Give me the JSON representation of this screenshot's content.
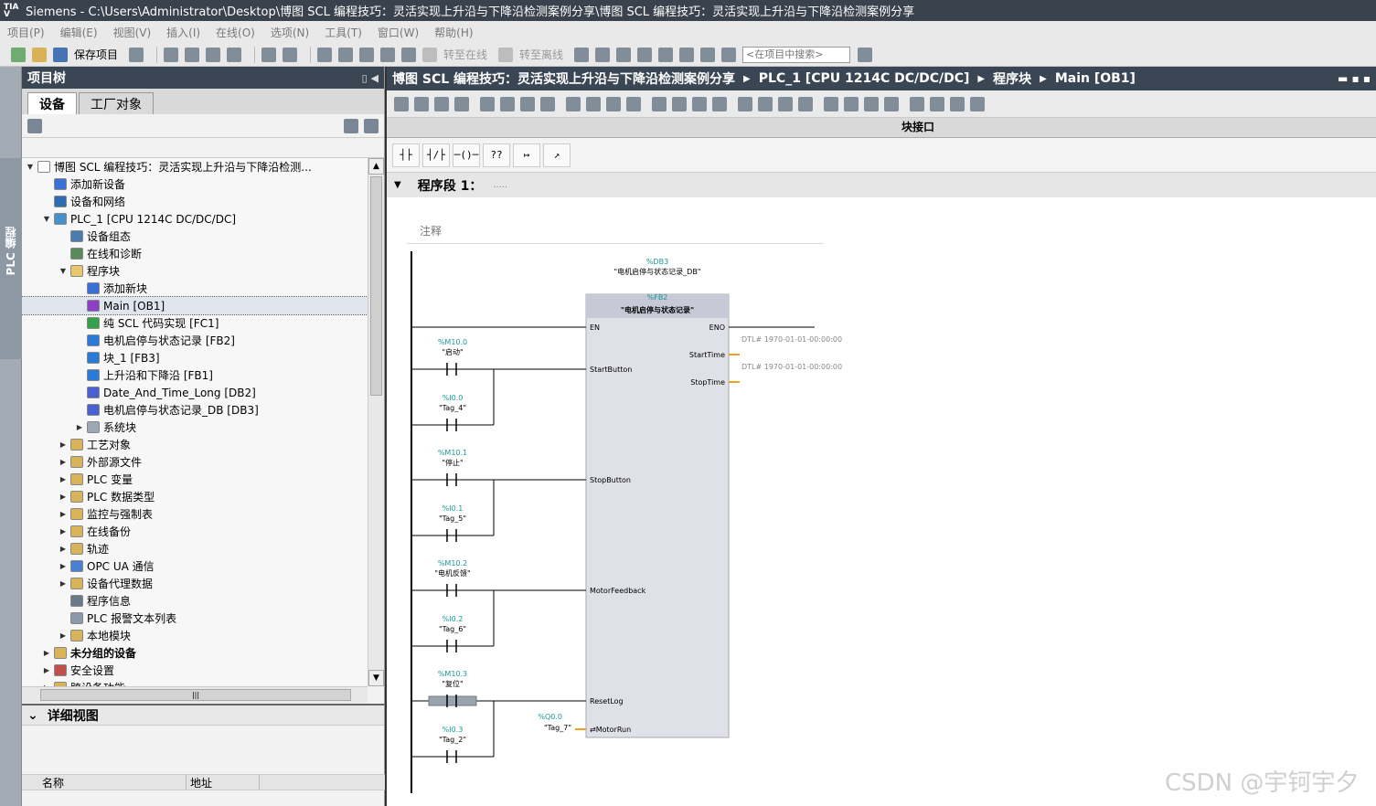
{
  "window": {
    "title": "Siemens  -  C:\\Users\\Administrator\\Desktop\\博图 SCL 编程技巧：灵活实现上升沿与下降沿检测案例分享\\博图 SCL 编程技巧：灵活实现上升沿与下降沿检测案例分享",
    "logo": "TIA"
  },
  "menu": [
    "项目(P)",
    "编辑(E)",
    "视图(V)",
    "插入(I)",
    "在线(O)",
    "选项(N)",
    "工具(T)",
    "窗口(W)",
    "帮助(H)"
  ],
  "toolbar": {
    "save_label": "保存项目",
    "go_online": "转至在线",
    "go_offline": "转至离线",
    "search_placeholder": "<在项目中搜索>"
  },
  "side_strip_label": "PLC 编程",
  "project_tree": {
    "title": "项目树",
    "tabs": [
      "设备",
      "工厂对象"
    ],
    "items": [
      {
        "label": "博图 SCL 编程技巧：灵活实现上升沿与下降沿检测...",
        "indent": 0,
        "arrow": "▼",
        "color": "#ffffff"
      },
      {
        "label": "添加新设备",
        "indent": 1,
        "arrow": "",
        "color": "#3a6fd8"
      },
      {
        "label": "设备和网络",
        "indent": 1,
        "arrow": "",
        "color": "#2d6cb3"
      },
      {
        "label": "PLC_1 [CPU 1214C DC/DC/DC]",
        "indent": 1,
        "arrow": "▼",
        "color": "#4a90c8"
      },
      {
        "label": "设备组态",
        "indent": 2,
        "arrow": "",
        "color": "#4a7cb0"
      },
      {
        "label": "在线和诊断",
        "indent": 2,
        "arrow": "",
        "color": "#5a8a5a"
      },
      {
        "label": "程序块",
        "indent": 2,
        "arrow": "▼",
        "color": "#e7c76b"
      },
      {
        "label": "添加新块",
        "indent": 3,
        "arrow": "",
        "color": "#3a6fd8"
      },
      {
        "label": "Main [OB1]",
        "indent": 3,
        "arrow": "",
        "color": "#8f3fc6",
        "selected": true
      },
      {
        "label": "纯 SCL 代码实现 [FC1]",
        "indent": 3,
        "arrow": "",
        "color": "#33a14a"
      },
      {
        "label": "电机启停与状态记录 [FB2]",
        "indent": 3,
        "arrow": "",
        "color": "#2a7ad8"
      },
      {
        "label": "块_1 [FB3]",
        "indent": 3,
        "arrow": "",
        "color": "#2a7ad8"
      },
      {
        "label": "上升沿和下降沿 [FB1]",
        "indent": 3,
        "arrow": "",
        "color": "#2a7ad8"
      },
      {
        "label": "Date_And_Time_Long [DB2]",
        "indent": 3,
        "arrow": "",
        "color": "#4a5fd0"
      },
      {
        "label": "电机启停与状态记录_DB [DB3]",
        "indent": 3,
        "arrow": "",
        "color": "#4a5fd0"
      },
      {
        "label": "系统块",
        "indent": 3,
        "arrow": "▶",
        "color": "#9ca8b5"
      },
      {
        "label": "工艺对象",
        "indent": 2,
        "arrow": "▶",
        "color": "#d9b35a"
      },
      {
        "label": "外部源文件",
        "indent": 2,
        "arrow": "▶",
        "color": "#d9b35a"
      },
      {
        "label": "PLC 变量",
        "indent": 2,
        "arrow": "▶",
        "color": "#d9b35a"
      },
      {
        "label": "PLC 数据类型",
        "indent": 2,
        "arrow": "▶",
        "color": "#d9b35a"
      },
      {
        "label": "监控与强制表",
        "indent": 2,
        "arrow": "▶",
        "color": "#d9b35a"
      },
      {
        "label": "在线备份",
        "indent": 2,
        "arrow": "▶",
        "color": "#d9b35a"
      },
      {
        "label": "轨迹",
        "indent": 2,
        "arrow": "▶",
        "color": "#d9b35a"
      },
      {
        "label": "OPC UA 通信",
        "indent": 2,
        "arrow": "▶",
        "color": "#4a80d0"
      },
      {
        "label": "设备代理数据",
        "indent": 2,
        "arrow": "▶",
        "color": "#d9b35a"
      },
      {
        "label": "程序信息",
        "indent": 2,
        "arrow": "",
        "color": "#6b7a8a"
      },
      {
        "label": "PLC 报警文本列表",
        "indent": 2,
        "arrow": "",
        "color": "#8a9aaa"
      },
      {
        "label": "本地模块",
        "indent": 2,
        "arrow": "▶",
        "color": "#d9b35a"
      },
      {
        "label": "未分组的设备",
        "indent": 1,
        "arrow": "▶",
        "color": "#d9b35a",
        "bold": true
      },
      {
        "label": "安全设置",
        "indent": 1,
        "arrow": "▶",
        "color": "#c0504d"
      },
      {
        "label": "跨设备功能",
        "indent": 1,
        "arrow": "▶",
        "color": "#d9b35a"
      }
    ]
  },
  "detail_view": {
    "title": "详细视图",
    "col_name": "名称",
    "col_addr": "地址"
  },
  "editor": {
    "breadcrumb": [
      "博图 SCL 编程技巧：灵活实现上升沿与下降沿检测案例分享",
      "PLC_1 [CPU 1214C DC/DC/DC]",
      "程序块",
      "Main [OB1]"
    ],
    "block_interface": "块接口",
    "ladder_buttons": [
      "┤├",
      "┤/├",
      "─()─",
      "??",
      "↦",
      "↗"
    ],
    "network_title": "程序段 1：",
    "network_dots": ".....",
    "comment": "注释"
  },
  "ladder": {
    "instance_db_addr": "%DB3",
    "instance_db_name": "\"电机启停与状态记录_DB\"",
    "fb_addr": "%FB2",
    "fb_name": "\"电机启停与状态记录\"",
    "en": "EN",
    "eno": "ENO",
    "inputs": [
      {
        "pin": "StartButton",
        "c1_addr": "%M10.0",
        "c1_name": "\"启动\"",
        "c2_addr": "%I0.0",
        "c2_name": "\"Tag_4\""
      },
      {
        "pin": "StopButton",
        "c1_addr": "%M10.1",
        "c1_name": "\"停止\"",
        "c2_addr": "%I0.1",
        "c2_name": "\"Tag_5\""
      },
      {
        "pin": "MotorFeedback",
        "c1_addr": "%M10.2",
        "c1_name": "\"电机反馈\"",
        "c2_addr": "%I0.2",
        "c2_name": "\"Tag_6\""
      },
      {
        "pin": "ResetLog",
        "c1_addr": "%M10.3",
        "c1_name": "\"复位\"",
        "c2_addr": "%I0.3",
        "c2_name": "\"Tag_2\""
      }
    ],
    "outputs": [
      {
        "pin": "StartTime",
        "value": "DTL# 1970-01-01-00:00:00"
      },
      {
        "pin": "StopTime",
        "value": "DTL# 1970-01-01-00:00:00"
      }
    ],
    "inout": {
      "pin": "⇄MotorRun",
      "addr": "%Q0.0",
      "name": "\"Tag_7\""
    }
  },
  "watermark": "CSDN @宇钶宇夕"
}
